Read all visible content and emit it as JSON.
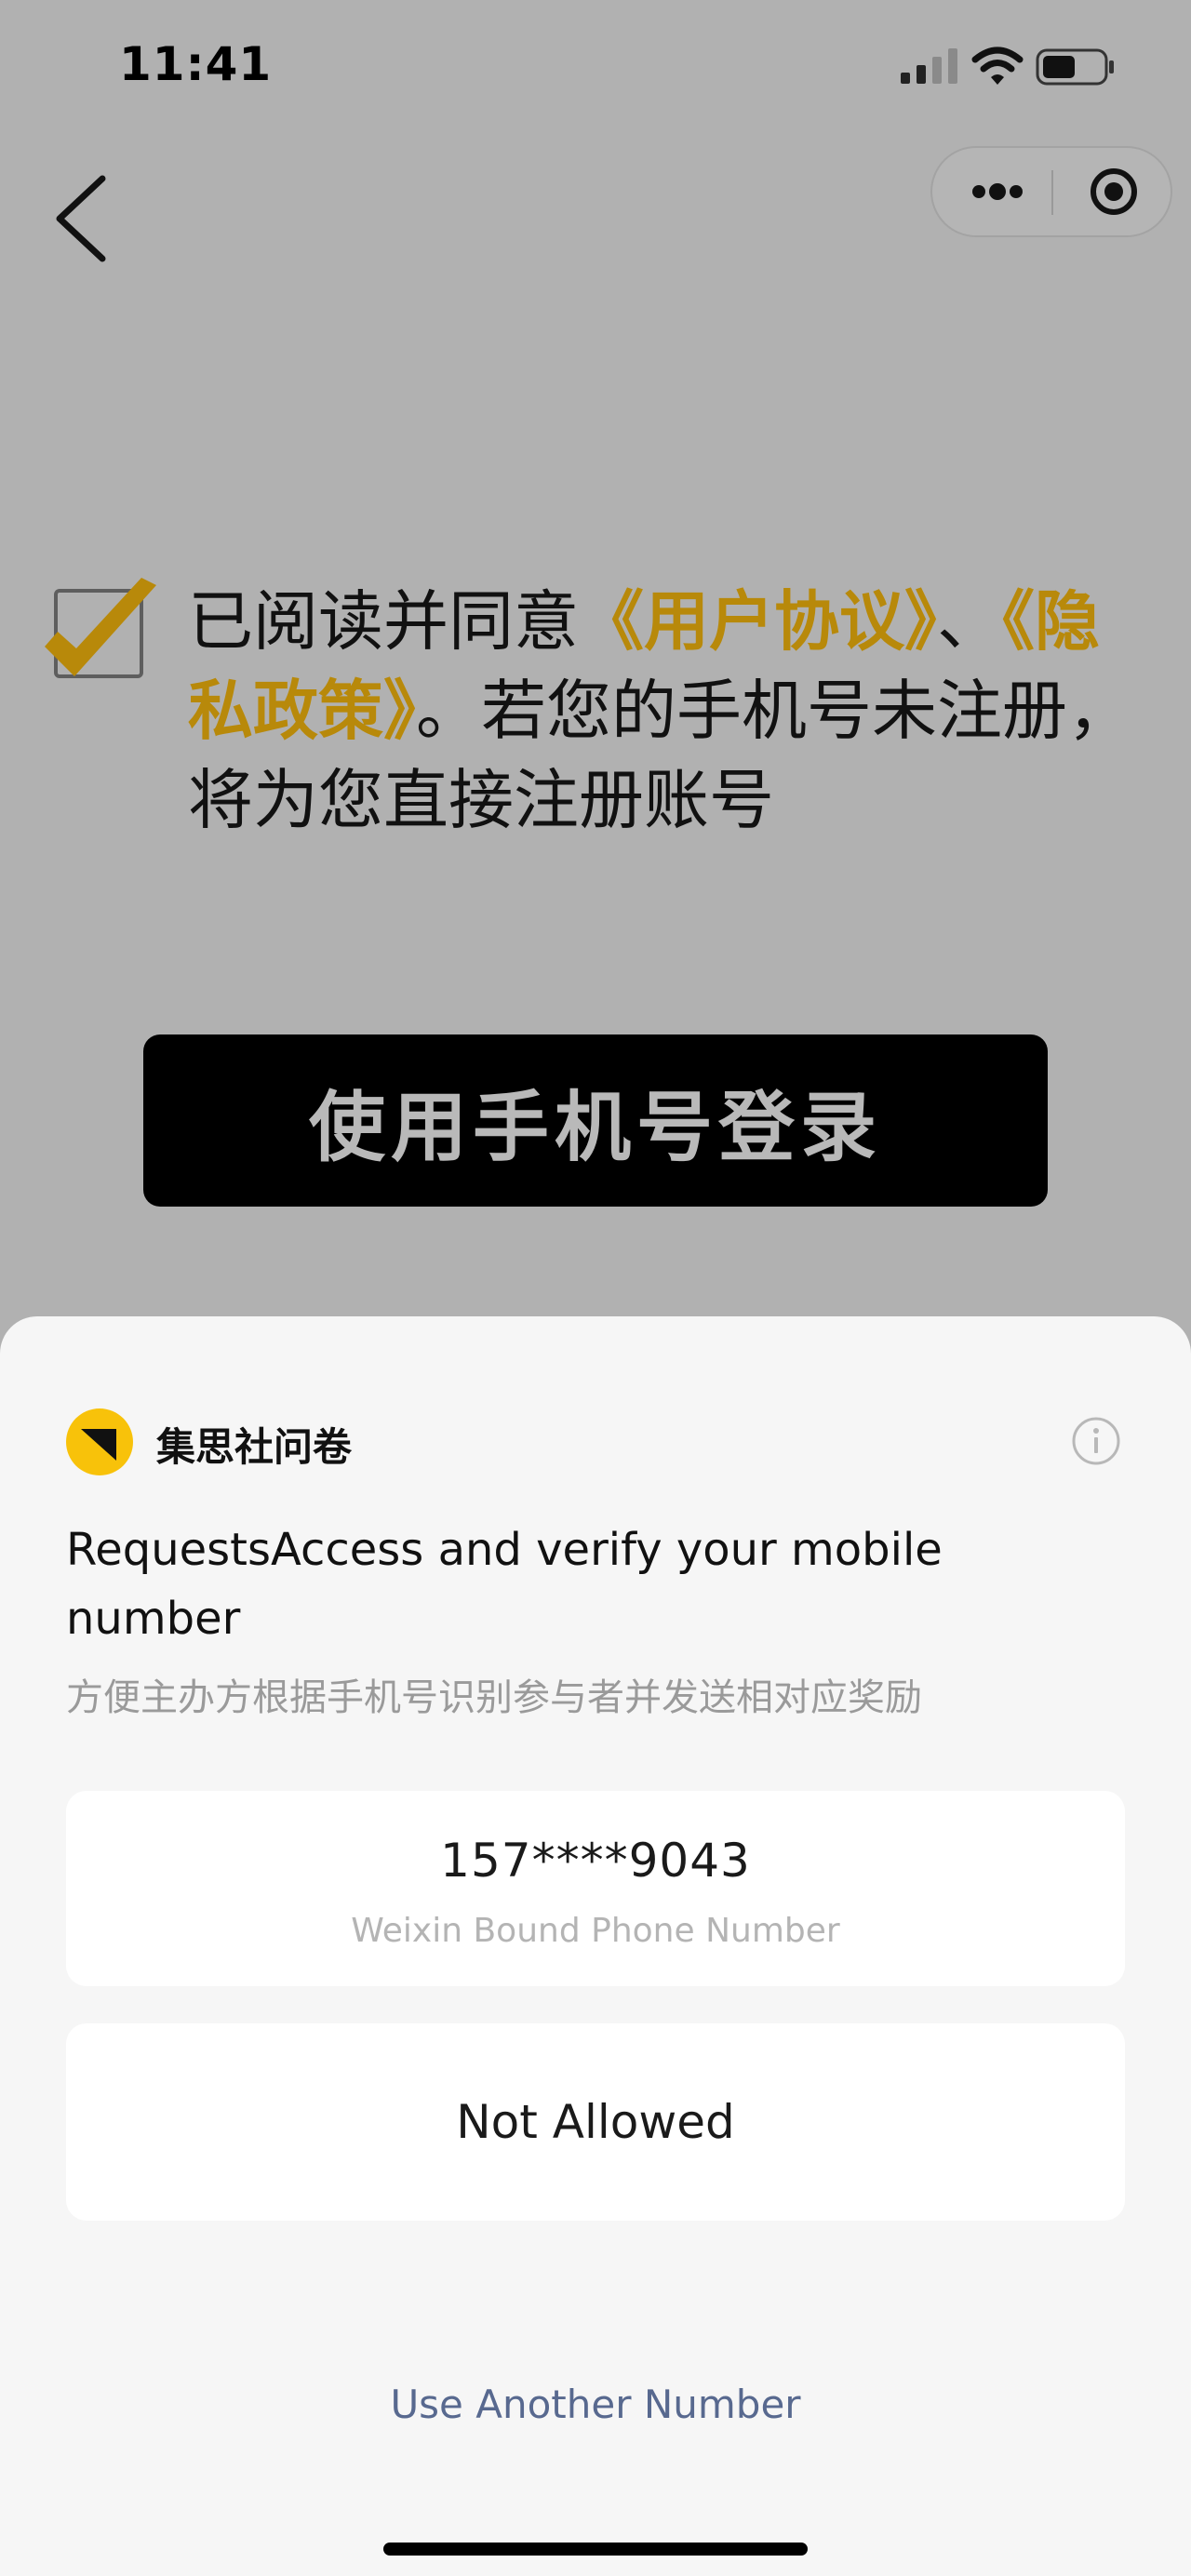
{
  "status_bar": {
    "time": "11:41",
    "icons": [
      "signal-icon",
      "wifi-icon",
      "battery-icon"
    ]
  },
  "nav": {
    "back_icon": "chevron-left-icon",
    "more_icon": "more-dots-icon",
    "close_icon": "target-close-icon"
  },
  "agreement": {
    "checked": true,
    "text_prefix": "已阅读并同意",
    "user_agreement_link": "《用户协议》",
    "separator": "、",
    "privacy_policy_link": "《隐私政策》",
    "text_suffix": "。若您的手机号未注册，将为您直接注册账号"
  },
  "login_button": {
    "label": "使用手机号登录"
  },
  "sheet": {
    "app_name": "集思社问卷",
    "info_icon": "info-icon",
    "title": "RequestsAccess and verify your mobile number",
    "subtitle": "方便主办方根据手机号识别参与者并发送相对应奖励",
    "phone_option": {
      "number": "157****9043",
      "caption": "Weixin Bound Phone Number"
    },
    "deny_option": {
      "label": "Not Allowed"
    },
    "another_number_link": "Use Another Number"
  },
  "colors": {
    "overlay_bg": "#b1b1b1",
    "link_gold": "#b8890a",
    "logo_yellow": "#f8c20a",
    "link_blue": "#58698f"
  }
}
